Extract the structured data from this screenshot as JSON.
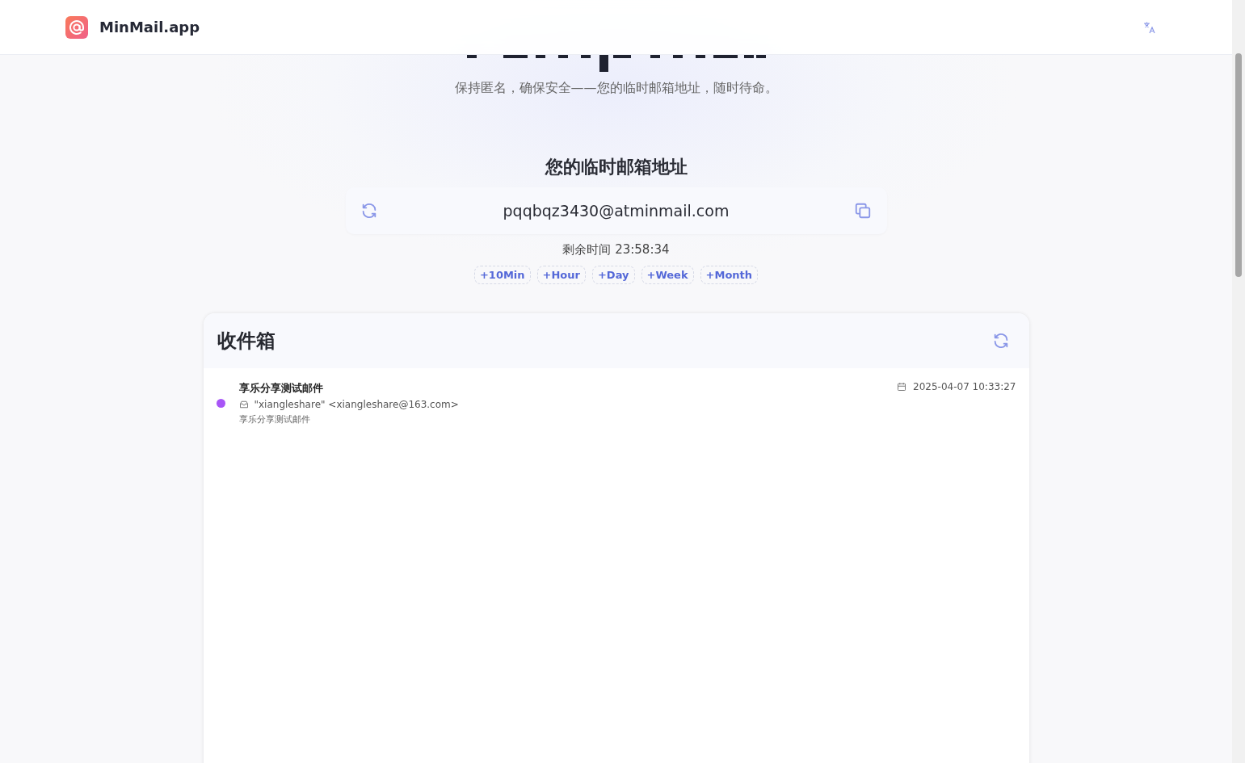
{
  "header": {
    "logo_text": "MinMail.app"
  },
  "hero": {
    "subtitle": "保持匿名，确保安全——您的临时邮箱地址，随时待命。"
  },
  "address": {
    "heading": "您的临时邮箱地址",
    "email": "pqqbqz3430@atminmail.com",
    "timer": "剩余时间 23:58:34",
    "extend_buttons": [
      "+10Min",
      "+Hour",
      "+Day",
      "+Week",
      "+Month"
    ]
  },
  "inbox": {
    "title": "收件箱",
    "messages": [
      {
        "subject": "享乐分享测试邮件",
        "from": "\"xiangleshare\" <xiangleshare@163.com>",
        "preview": "享乐分享测试邮件",
        "date": "2025-04-07 10:33:27",
        "unread": true
      }
    ]
  }
}
